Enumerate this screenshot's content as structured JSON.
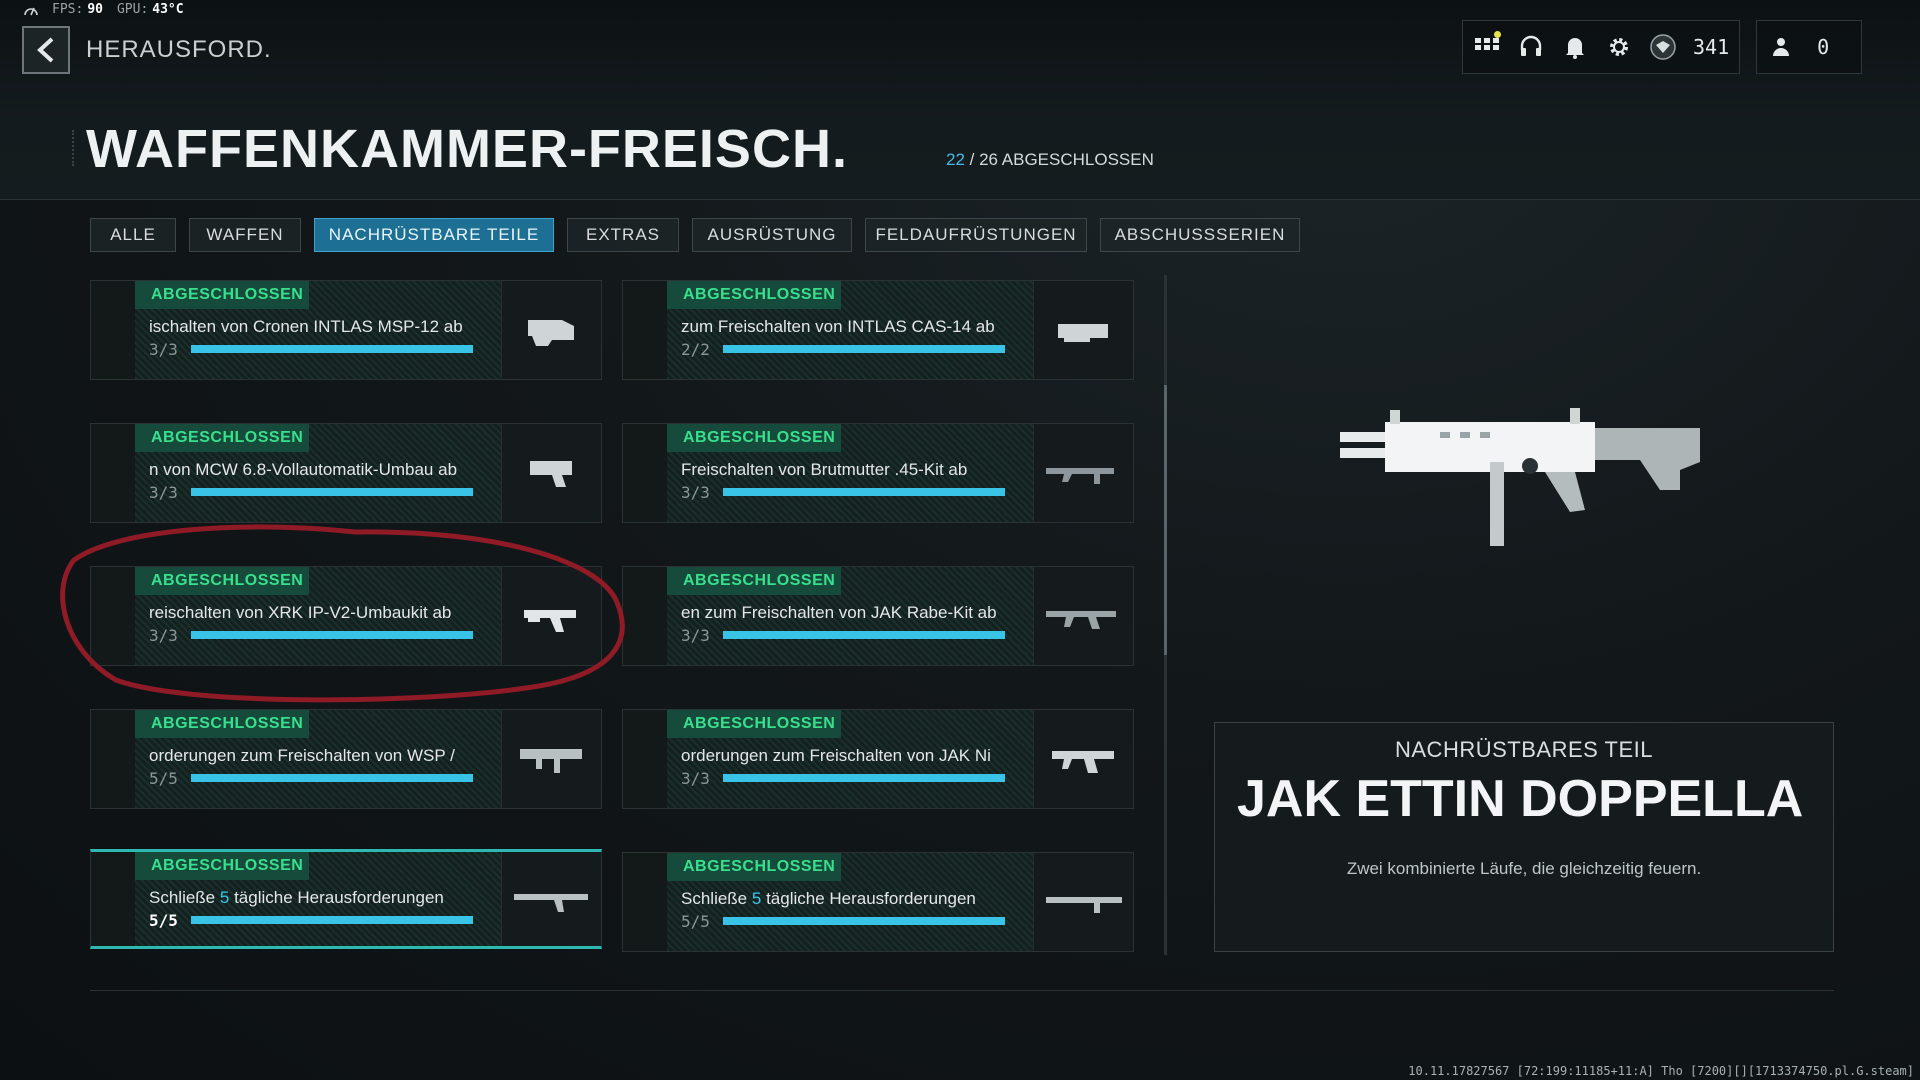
{
  "overlay": {
    "fps_label": "FPS:",
    "fps_value": "90",
    "gpu_label": "GPU:",
    "gpu_value": "43°C"
  },
  "header": {
    "breadcrumb": "HERAUSFORD.",
    "title": "WAFFENKAMMER-FREISCH.",
    "progress_done": "22",
    "progress_rest": " / 26 ABGESCHLOSSEN"
  },
  "topbar": {
    "currency_value": "341",
    "friends_count": "0"
  },
  "tabs": [
    {
      "label": "ALLE"
    },
    {
      "label": "WAFFEN"
    },
    {
      "label": "NACHRÜSTBARE TEILE",
      "active": true
    },
    {
      "label": "EXTRAS"
    },
    {
      "label": "AUSRÜSTUNG"
    },
    {
      "label": "FELDAUFRÜSTUNGEN"
    },
    {
      "label": "ABSCHUSSSERIEN"
    }
  ],
  "cards": [
    {
      "status": "ABGESCHLOSSEN",
      "text": "ischalten von Cronen INTLAS MSP-12 ab",
      "ratio": "3/3",
      "progress": 1.0
    },
    {
      "status": "ABGESCHLOSSEN",
      "text": "zum Freischalten von INTLAS CAS-14 ab",
      "ratio": "2/2",
      "progress": 1.0
    },
    {
      "status": "ABGESCHLOSSEN",
      "text": "n von MCW 6.8-Vollautomatik-Umbau ab",
      "ratio": "3/3",
      "progress": 1.0
    },
    {
      "status": "ABGESCHLOSSEN",
      "text": "Freischalten von Brutmutter .45-Kit ab",
      "ratio": "3/3",
      "progress": 1.0
    },
    {
      "status": "ABGESCHLOSSEN",
      "text": "reischalten von XRK IP-V2-Umbaukit ab",
      "ratio": "3/3",
      "progress": 1.0
    },
    {
      "status": "ABGESCHLOSSEN",
      "text": "en zum Freischalten von JAK Rabe-Kit ab",
      "ratio": "3/3",
      "progress": 1.0
    },
    {
      "status": "ABGESCHLOSSEN",
      "text": "orderungen zum Freischalten von WSP /",
      "ratio": "5/5",
      "progress": 1.0
    },
    {
      "status": "ABGESCHLOSSEN",
      "text": "orderungen zum Freischalten von JAK Ni",
      "ratio": "3/3",
      "progress": 1.0
    },
    {
      "status": "ABGESCHLOSSEN",
      "text_pre": "Schließe ",
      "text_num": "5",
      "text_post": " tägliche Herausforderungen",
      "ratio": "5/5",
      "progress": 1.0,
      "selected": true
    },
    {
      "status": "ABGESCHLOSSEN",
      "text_pre": "Schließe ",
      "text_num": "5",
      "text_post": " tägliche Herausforderungen",
      "ratio": "5/5",
      "progress": 1.0
    }
  ],
  "detail": {
    "kind": "NACHRÜSTBARES TEIL",
    "name": "JAK ETTIN DOPPELLA",
    "description": "Zwei kombinierte Läufe, die gleichzeitig feuern."
  },
  "build_string": "10.11.17827567 [72:199:11185+11:A] Tho [7200][][1713374750.pl.G.steam]",
  "colors": {
    "accent_blue": "#39c3e6",
    "complete_green": "#38e08e",
    "annotation_red": "#8e1b26"
  }
}
